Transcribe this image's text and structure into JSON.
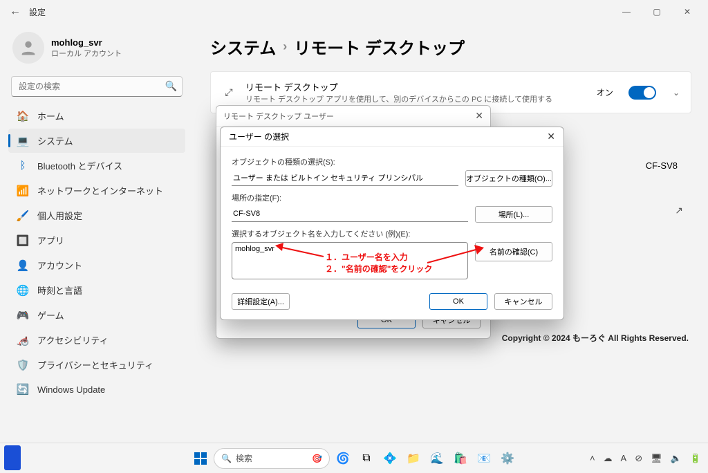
{
  "window": {
    "title": "設定",
    "minimize": "—",
    "maximize": "▢",
    "close": "✕"
  },
  "user": {
    "name": "mohlog_svr",
    "sub": "ローカル アカウント"
  },
  "search": {
    "placeholder": "設定の検索"
  },
  "nav": {
    "home": "ホーム",
    "system": "システム",
    "bluetooth": "Bluetooth とデバイス",
    "network": "ネットワークとインターネット",
    "personalize": "個人用設定",
    "apps": "アプリ",
    "accounts": "アカウント",
    "time": "時刻と言語",
    "game": "ゲーム",
    "accessibility": "アクセシビリティ",
    "privacy": "プライバシーとセキュリティ",
    "update": "Windows Update"
  },
  "bread": {
    "root": "システム",
    "leaf": "リモート デスクトップ"
  },
  "rd_card": {
    "title": "リモート デスクトップ",
    "sub": "リモート デスクトップ アプリを使用して、別のデバイスからこの PC に接続して使用する",
    "on": "オン"
  },
  "pcname_value": "CF-SV8",
  "dlg1": {
    "title": "リモート デスクトップ ユーザー",
    "ok": "OK",
    "cancel": "キャンセル"
  },
  "dlg2": {
    "title": "ユーザー の選択",
    "objtype_label": "オブジェクトの種類の選択(S):",
    "objtype_value": "ユーザー または ビルトイン セキュリティ プリンシパル",
    "objtype_btn": "オブジェクトの種類(O)...",
    "loc_label": "場所の指定(F):",
    "loc_value": "CF-SV8",
    "loc_btn": "場所(L)...",
    "name_label": "選択するオブジェクト名を入力してください (例)(E):",
    "name_value": "mohlog_svr",
    "check_btn": "名前の確認(C)",
    "advanced_btn": "詳細設定(A)...",
    "ok": "OK",
    "cancel": "キャンセル"
  },
  "annot": {
    "line1": "１．ユーザー名を入力",
    "line2": "２．\"名前の確認\"をクリック"
  },
  "copyright": "Copyright © 2024 もーろぐ All Rights Reserved.",
  "taskbar": {
    "search": "検索"
  },
  "icons": {
    "rd_arrows": "⤢"
  }
}
